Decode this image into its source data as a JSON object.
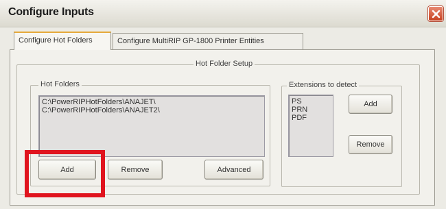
{
  "window": {
    "title": "Configure Inputs",
    "close_icon": "close-icon",
    "close_color": "#d9553a"
  },
  "tabs": [
    {
      "label": "Configure Hot Folders",
      "active": true
    },
    {
      "label": "Configure MultiRIP GP-1800 Printer Entities",
      "active": false
    }
  ],
  "setup": {
    "title": "Hot Folder Setup",
    "hot_folders": {
      "title": "Hot Folders",
      "items": [
        "C:\\PowerRIPHotFolders\\ANAJET\\",
        "C:\\PowerRIPHotFolders\\ANAJET2\\"
      ],
      "add_label": "Add",
      "remove_label": "Remove",
      "advanced_label": "Advanced"
    },
    "extensions": {
      "title": "Extensions to detect",
      "items": [
        "PS",
        "PRN",
        "PDF"
      ],
      "add_label": "Add",
      "remove_label": "Remove"
    }
  },
  "annotation": {
    "color": "#e0141e",
    "target": "Add"
  }
}
